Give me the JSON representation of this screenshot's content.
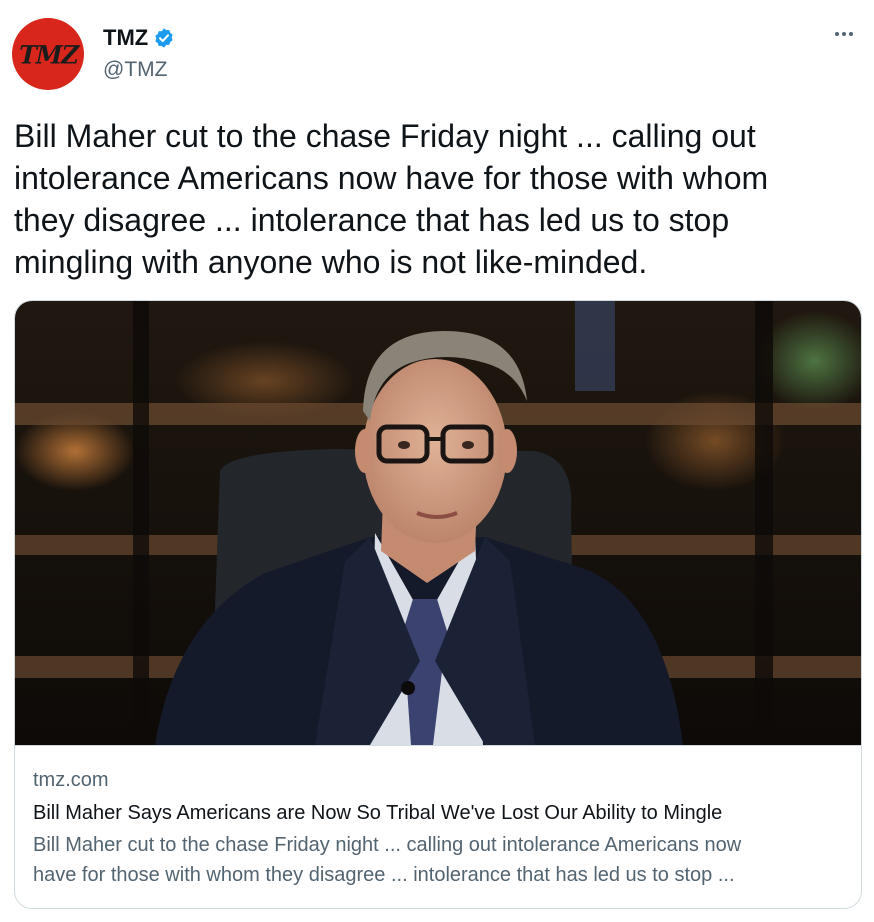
{
  "author": {
    "display_name": "TMZ",
    "handle": "@TMZ",
    "verified": true,
    "avatar_text": "TMZ",
    "avatar_color": "#d8261c"
  },
  "more_icon": "more-horizontal-icon",
  "tweet": {
    "text": "Bill Maher cut to the chase Friday night ... calling out\nintolerance Americans now have for those with whom\nthey disagree ... intolerance that has led us to stop\nmingling with anyone who is not like-minded."
  },
  "card": {
    "domain": "tmz.com",
    "title": "Bill Maher Says Americans are Now So Tribal We've Lost Our Ability to Mingle",
    "description": "Bill Maher cut to the chase Friday night ... calling out intolerance Americans now\nhave for those with whom they disagree ... intolerance that has led us to stop ..."
  },
  "colors": {
    "verified_blue": "#1d9bf0",
    "text_primary": "#0f1419",
    "text_secondary": "#536471",
    "border": "#cfd9de"
  }
}
